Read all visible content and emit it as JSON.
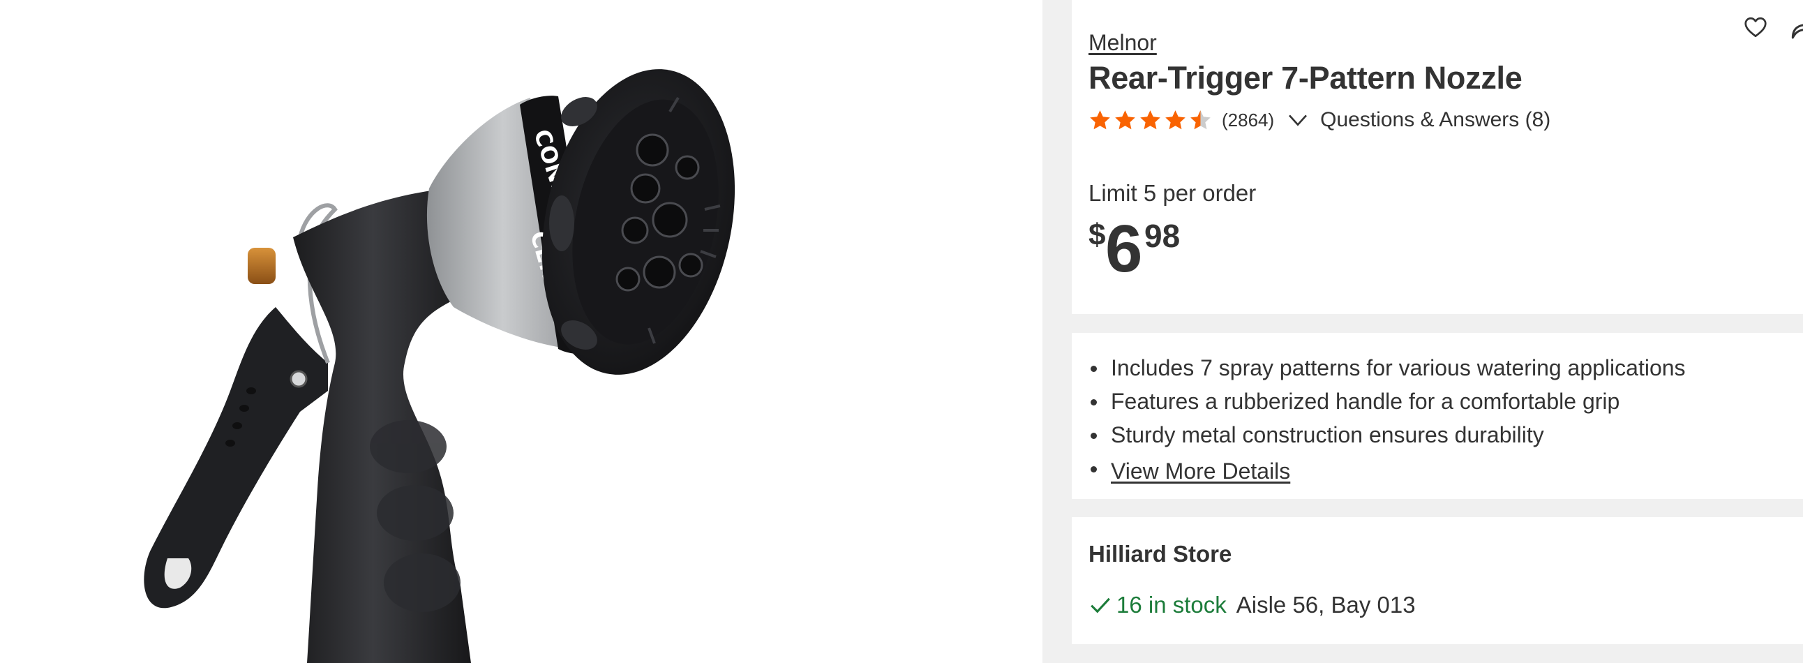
{
  "product": {
    "brand": "Melnor",
    "title": "Rear-Trigger 7-Pattern Nozzle",
    "rating": 4.5,
    "rating_max": 5,
    "review_count": "(2864)",
    "qa_label": "Questions & Answers (8)"
  },
  "purchase": {
    "limit_text": "Limit 5 per order",
    "price_currency": "$",
    "price_dollars": "6",
    "price_cents": "98"
  },
  "highlights": [
    "Includes 7 spray patterns for various watering applications",
    "Features a rubberized handle for a comfortable grip",
    "Sturdy metal construction ensures durability"
  ],
  "view_more_label": "View More Details",
  "store": {
    "name": "Hilliard Store",
    "stock_text": "16 in stock",
    "aisle_text": "Aisle 56, Bay 013"
  },
  "image": {
    "nozzle_labels": [
      "CONE",
      "CENTER"
    ]
  },
  "colors": {
    "star": "#f96302",
    "star_empty": "#cccccc",
    "in_stock": "#1c7c3a",
    "text": "#333333",
    "panel_bg": "#f0f0f0"
  },
  "icons": {
    "favorite": "heart-icon",
    "share": "share-icon",
    "expand": "chevron-down-icon",
    "stock": "checkmark-icon"
  }
}
